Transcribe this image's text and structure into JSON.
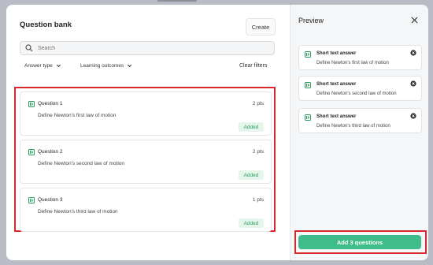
{
  "left": {
    "title": "Question bank",
    "create_label": "Create",
    "search_placeholder": "Search",
    "filters": [
      {
        "label": "Answer type"
      },
      {
        "label": "Learning outcomes"
      }
    ],
    "clear_filters_label": "Clear filters",
    "questions": [
      {
        "title": "Question 1",
        "points": "2 pts",
        "text": "Define Newton's first law of motion",
        "status": "Added"
      },
      {
        "title": "Question 2",
        "points": "2 pts",
        "text": "Define Newton's second law of motion",
        "status": "Added"
      },
      {
        "title": "Question 3",
        "points": "1 pts",
        "text": "Define Newton's third law of motion",
        "status": "Added"
      }
    ]
  },
  "right": {
    "title": "Preview",
    "items": [
      {
        "type": "Short text answer",
        "text": "Define Newton's first law of motion"
      },
      {
        "type": "Short text answer",
        "text": "Define Newton's second law of motion"
      },
      {
        "type": "Short text answer",
        "text": "Define Newton's third law of motion"
      }
    ],
    "add_button_label": "Add 3 questions"
  },
  "colors": {
    "accent_green": "#3ebd8a",
    "added_badge_text": "#2e9b5f",
    "highlight_outline": "#d62a2a"
  },
  "icons": {
    "question": "question-type-icon",
    "search": "search-icon",
    "chevron": "chevron-down-icon",
    "close": "close-icon",
    "remove": "remove-circle-icon"
  }
}
